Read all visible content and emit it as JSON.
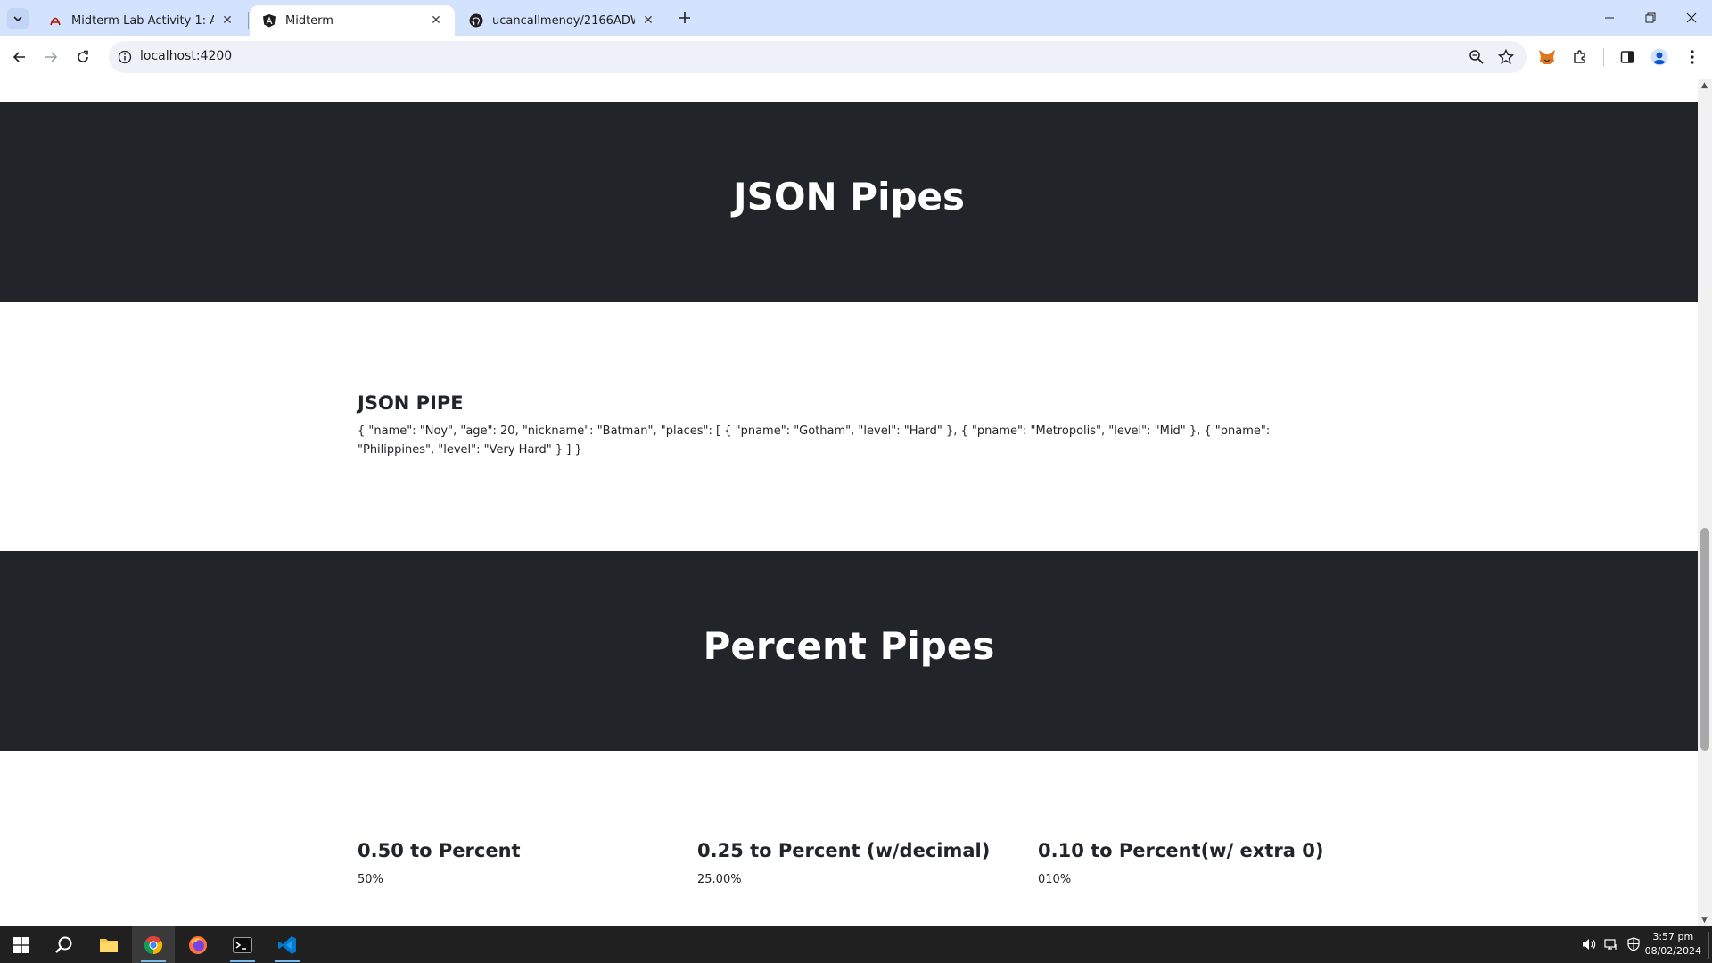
{
  "browser": {
    "tabs": [
      {
        "title": "Midterm Lab Activity 1: Angular",
        "active": false,
        "icon": "acrobat-icon"
      },
      {
        "title": "Midterm",
        "active": true,
        "icon": "angular-icon"
      },
      {
        "title": "ucancallmenoy/2166ADWEB",
        "active": false,
        "icon": "github-icon"
      }
    ],
    "url": "localhost:4200"
  },
  "page": {
    "json_section": {
      "banner_title": "JSON Pipes",
      "heading": "JSON PIPE",
      "output": "{ \"name\": \"Noy\", \"age\": 20, \"nickname\": \"Batman\", \"places\": [ { \"pname\": \"Gotham\", \"level\": \"Hard\" }, { \"pname\": \"Metropolis\", \"level\": \"Mid\" }, { \"pname\": \"Philippines\", \"level\": \"Very Hard\" } ] }"
    },
    "percent_section": {
      "banner_title": "Percent Pipes",
      "items": [
        {
          "heading": "0.50 to Percent",
          "value": "50%"
        },
        {
          "heading": "0.25 to Percent (w/decimal)",
          "value": "25.00%"
        },
        {
          "heading": "0.10 to Percent(w/ extra 0)",
          "value": "010%"
        }
      ]
    }
  },
  "taskbar": {
    "time": "3:57 pm",
    "date": "08/02/2024"
  },
  "colors": {
    "banner_bg": "#212529",
    "tabstrip_bg": "#d3e3fd",
    "taskbar_bg": "#202020"
  }
}
